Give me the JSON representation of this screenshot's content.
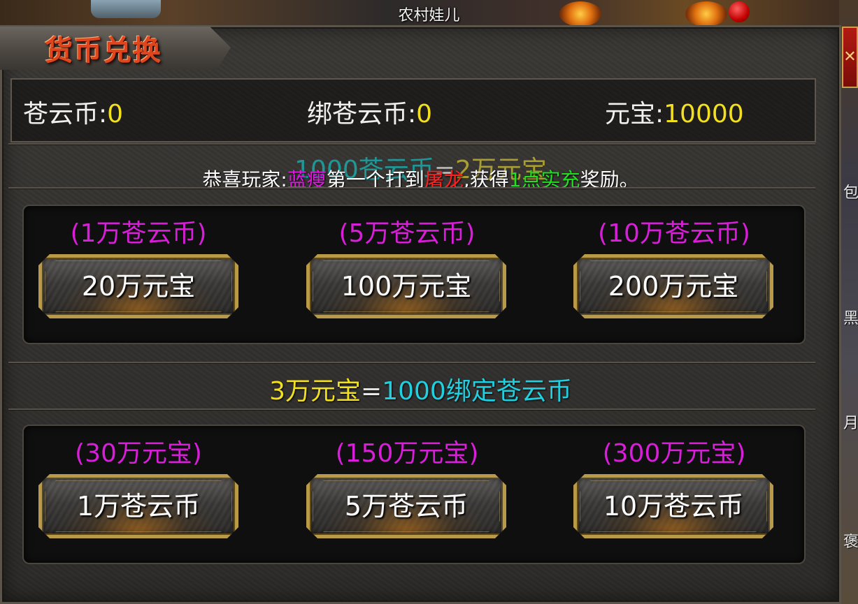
{
  "header": {
    "character_name": "农村娃儿"
  },
  "window": {
    "title": "货币兑换",
    "close_symbol": "✕"
  },
  "balances": {
    "canyun": {
      "label": "苍云币:",
      "value": "0"
    },
    "bound_canyun": {
      "label": "绑苍云币:",
      "value": "0"
    },
    "yuanbao": {
      "label": "元宝:",
      "value": "10000"
    }
  },
  "rate_top": {
    "left": "1000苍云币",
    "eq": "=",
    "right": "2万元宝"
  },
  "announcement": {
    "prefix": "恭喜玩家:",
    "player": "蓝瘦",
    "middle": "第一个打到",
    "boss": "屠龙",
    "middle2": ",获得",
    "reward": "1点实充",
    "suffix": "奖励。"
  },
  "buy_canyun": [
    {
      "price": "(1万苍云币)",
      "button": "20万元宝"
    },
    {
      "price": "(5万苍云币)",
      "button": "100万元宝"
    },
    {
      "price": "(10万苍云币)",
      "button": "200万元宝"
    }
  ],
  "rate_bottom": {
    "left": "3万元宝",
    "eq": "=",
    "right": "1000绑定苍云币"
  },
  "buy_bound": [
    {
      "price": "(30万元宝)",
      "button": "1万苍云币"
    },
    {
      "price": "(150万元宝)",
      "button": "5万苍云币"
    },
    {
      "price": "(300万元宝)",
      "button": "10万苍云币"
    }
  ],
  "side_glyphs": [
    "包",
    "黑",
    "月",
    "褒"
  ],
  "colors": {
    "title": "#e0461e",
    "value_yellow": "#f2e020",
    "price_magenta": "#d81ed8",
    "cyan": "#20d0e0",
    "reward_green": "#20e020",
    "boss_red": "#ff2020",
    "button_border": "#b89a48"
  }
}
